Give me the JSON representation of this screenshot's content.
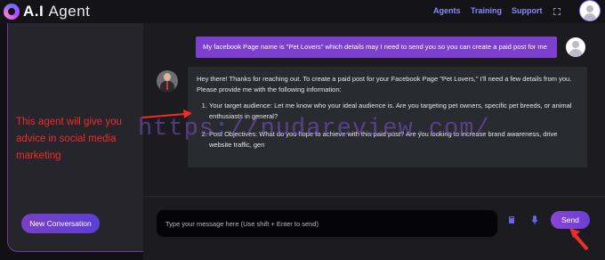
{
  "app": {
    "logo_primary": "A.I",
    "logo_secondary": "Agent"
  },
  "nav": {
    "items": [
      {
        "label": "Agents"
      },
      {
        "label": "Training"
      },
      {
        "label": "Support"
      }
    ],
    "icons": {
      "expand": "expand-icon",
      "user": "user-avatar"
    }
  },
  "sidebar": {
    "new_conversation_label": "New Conversation"
  },
  "chat": {
    "user_message": "My facebook Page name is \"Pet Lovers\" which details may I need to send you so you can create a paid post for me",
    "bot_intro": "Hey there! Thanks for reaching out. To create a paid post for your Facebook Page \"Pet Lovers,\" I'll need a few details from you. Please provide me with the following information:",
    "bot_items": [
      "Your target audience: Let me know who your ideal audience is. Are you targeting pet owners, specific pet breeds, or animal enthusiasts in general?",
      "Post Objectives: What do you hope to achieve with this paid post? Are you looking to increase brand awareness, drive website traffic, gen"
    ]
  },
  "overlay": {
    "watermark": "https://nudareview.com/",
    "annotation": "This agent will give you advice in social media marketing"
  },
  "composer": {
    "placeholder": "Type your message here (Use shift + Enter to send)",
    "send_label": "Send",
    "icons": [
      "book-icon",
      "microphone-icon"
    ]
  },
  "colors": {
    "accent": "#7c3fd0",
    "nav_link": "#8d86ff",
    "annotation": "#ef2b2b"
  }
}
